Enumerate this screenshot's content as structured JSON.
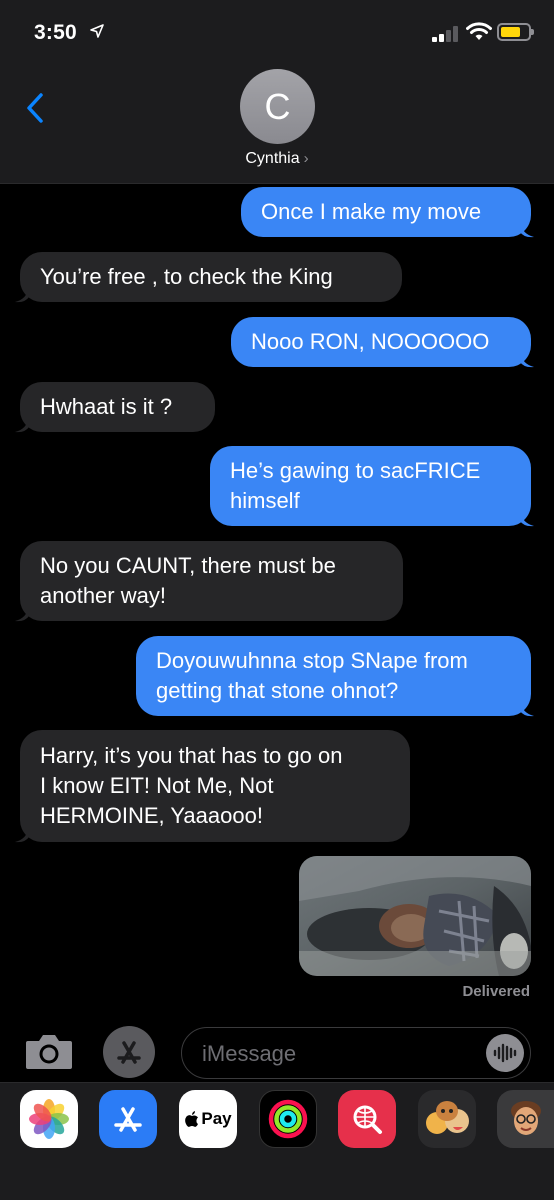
{
  "status_bar": {
    "time": "3:50"
  },
  "header": {
    "avatar_initial": "C",
    "contact_name": "Cynthia",
    "contact_chevron": "›"
  },
  "messages": [
    {
      "direction": "sent",
      "text": "Once I make my move"
    },
    {
      "direction": "received",
      "text": "You’re free , to check the King"
    },
    {
      "direction": "sent",
      "text": "Nooo RON, NOOOOOO"
    },
    {
      "direction": "received",
      "text": "Hwhaat is it ?"
    },
    {
      "direction": "sent",
      "text": "He’s gawing to sacFRICE\nhimself"
    },
    {
      "direction": "received",
      "text": "No you CAUNT, there must be\nanother way!"
    },
    {
      "direction": "sent",
      "text": "Doyouwuhnna stop SNape from\ngetting that stone ohnot?"
    },
    {
      "direction": "received",
      "text": "Harry, it’s you that has to go on\nI know EIT! Not Me, Not\nHERMOINE, Yaaaooo!"
    },
    {
      "direction": "sent",
      "type": "image"
    }
  ],
  "delivery_status": "Delivered",
  "compose": {
    "placeholder": "iMessage"
  },
  "app_drawer": {
    "pay_label": "Pay",
    "apps": [
      "photos-icon",
      "app-store-icon",
      "apple-pay-icon",
      "activity-icon",
      "web-search-icon",
      "animoji-icon",
      "memoji-icon"
    ]
  },
  "colors": {
    "sent_bubble": "#3a86f5",
    "received_bubble": "#262628",
    "accent": "#0a84ff"
  }
}
